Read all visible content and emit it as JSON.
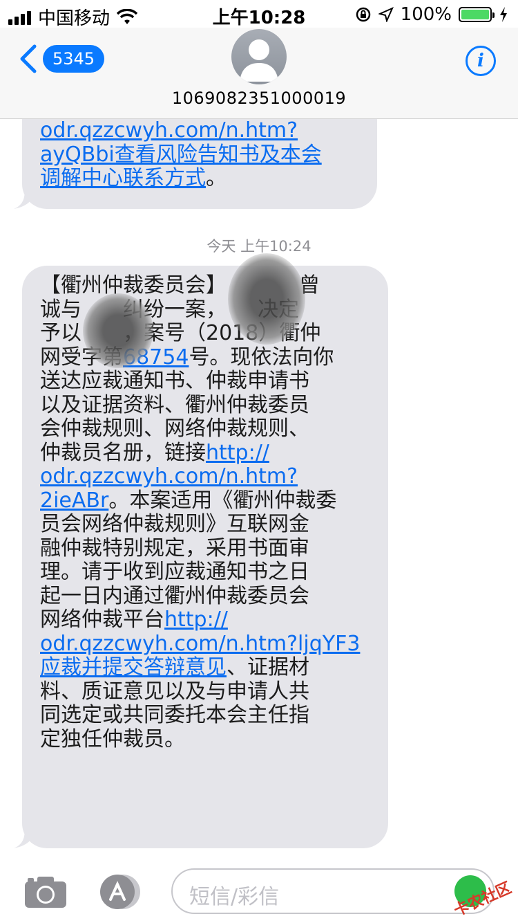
{
  "status_bar": {
    "carrier": "中国移动",
    "time": "上午10:28",
    "battery_percent": "100%",
    "battery_level": 1.0
  },
  "header": {
    "back_badge": "5345",
    "contact_number": "1069082351000019",
    "info_label": "i"
  },
  "conversation": {
    "timestamp": "今天 上午10:24",
    "previous_message_lines": [
      {
        "segments": [
          {
            "text": "odr.qzzcwyh.com/n.htm?",
            "link": true
          }
        ]
      },
      {
        "segments": [
          {
            "text": "ayQBbi查看风险告知书及本会",
            "link": true
          }
        ]
      },
      {
        "segments": [
          {
            "text": "调解中心联系方式",
            "link": true
          },
          {
            "text": "。",
            "link": false
          }
        ]
      }
    ],
    "message_lines": [
      {
        "segments": [
          {
            "text": "【衢州仲裁委员会】",
            "link": false
          },
          {
            "text": "　　　　曾",
            "link": false
          }
        ]
      },
      {
        "segments": [
          {
            "text": "诚与　　纠纷一案，　　决定",
            "link": false
          }
        ]
      },
      {
        "segments": [
          {
            "text": "予以　　，案号（2018）衢仲",
            "link": false
          }
        ]
      },
      {
        "segments": [
          {
            "text": "网受字第",
            "link": false
          },
          {
            "text": "68754",
            "link": true
          },
          {
            "text": "号。现依法向你",
            "link": false
          }
        ]
      },
      {
        "segments": [
          {
            "text": "送达应裁通知书、仲裁申请书",
            "link": false
          }
        ]
      },
      {
        "segments": [
          {
            "text": "以及证据资料、衢州仲裁委员",
            "link": false
          }
        ]
      },
      {
        "segments": [
          {
            "text": "会仲裁规则、网络仲裁规则、",
            "link": false
          }
        ]
      },
      {
        "segments": [
          {
            "text": "仲裁员名册，链接",
            "link": false
          },
          {
            "text": "http://",
            "link": true
          }
        ]
      },
      {
        "segments": [
          {
            "text": "odr.qzzcwyh.com/n.htm?",
            "link": true
          }
        ]
      },
      {
        "segments": [
          {
            "text": "2ieABr",
            "link": true
          },
          {
            "text": "。本案适用《衢州仲裁委",
            "link": false
          }
        ]
      },
      {
        "segments": [
          {
            "text": "员会网络仲裁规则》互联网金",
            "link": false
          }
        ]
      },
      {
        "segments": [
          {
            "text": "融仲裁特别规定，采用书面审",
            "link": false
          }
        ]
      },
      {
        "segments": [
          {
            "text": "理。请于收到应裁通知书之日",
            "link": false
          }
        ]
      },
      {
        "segments": [
          {
            "text": "起一日内通过衢州仲裁委员会",
            "link": false
          }
        ]
      },
      {
        "segments": [
          {
            "text": "网络仲裁平台",
            "link": false
          },
          {
            "text": "http://",
            "link": true
          }
        ]
      },
      {
        "segments": [
          {
            "text": "odr.qzzcwyh.com/n.htm?ljqYF3",
            "link": true
          }
        ]
      },
      {
        "segments": [
          {
            "text": "应裁并提交答辩意见",
            "link": true
          },
          {
            "text": "、证据材",
            "link": false
          }
        ]
      },
      {
        "segments": [
          {
            "text": "料、质证意见以及与申请人共",
            "link": false
          }
        ]
      },
      {
        "segments": [
          {
            "text": "同选定或共同委托本会主任指",
            "link": false
          }
        ]
      },
      {
        "segments": [
          {
            "text": "定独任仲裁员。",
            "link": false
          }
        ]
      }
    ]
  },
  "input_bar": {
    "placeholder": "短信/彩信",
    "watermark": "卡农社区"
  },
  "colors": {
    "accent": "#0a7aff",
    "link": "#0a6cf0",
    "bubble": "#e5e5ea",
    "battery": "#4cd964"
  },
  "icons": [
    "signal-icon",
    "wifi-icon",
    "lock-rotation-icon",
    "location-icon",
    "battery-icon",
    "charging-icon",
    "back-chevron-icon",
    "avatar-icon",
    "info-icon",
    "camera-icon",
    "appstore-icon",
    "mic-icon"
  ]
}
